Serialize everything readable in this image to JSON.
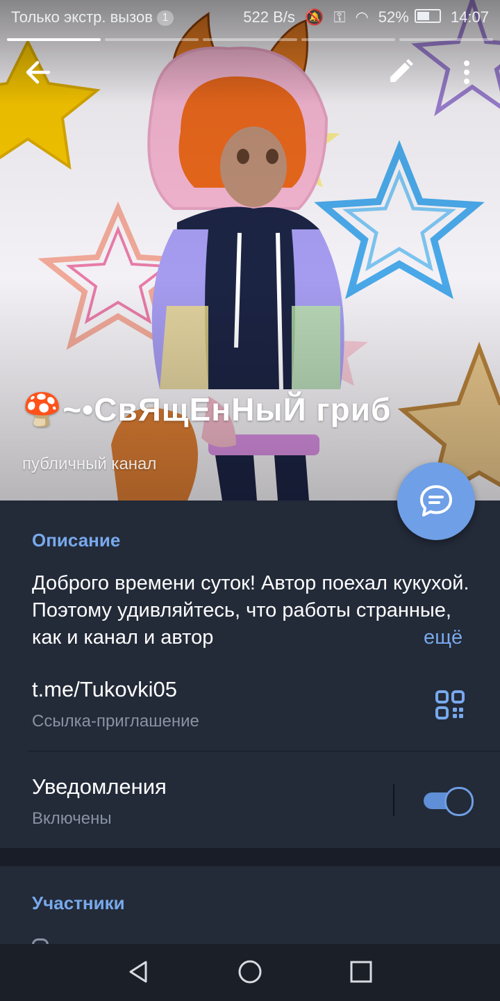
{
  "status_bar": {
    "carrier": "Только экстр. вызов",
    "sim_badge": "1",
    "net_speed": "522 B/s",
    "battery": "52%",
    "time": "14:07"
  },
  "channel": {
    "emoji": "🍄",
    "title": "~•СвЯщЕнНыЙ гриб",
    "subtitle": "публичный канал"
  },
  "info": {
    "description_label": "Описание",
    "description": "Доброго времени суток! Автор поехал кукухой. Поэтому удивляйтесь, что работы странные, как и канал и автор",
    "more_label": "ещё",
    "link": "t.me/Tukovki05",
    "link_caption": "Ссылка-приглашение",
    "notifications_label": "Уведомления",
    "notifications_state": "Включены",
    "notifications_enabled": true
  },
  "members": {
    "label": "Участники"
  },
  "colors": {
    "accent": "#78a9ec",
    "fab": "#6f9fe6",
    "card_bg": "#232a38"
  },
  "icons": [
    "back-arrow-icon",
    "pencil-icon",
    "more-vert-icon",
    "chat-bubble-icon",
    "qr-code-icon",
    "nav-back-icon",
    "nav-home-icon",
    "nav-recent-icon"
  ]
}
